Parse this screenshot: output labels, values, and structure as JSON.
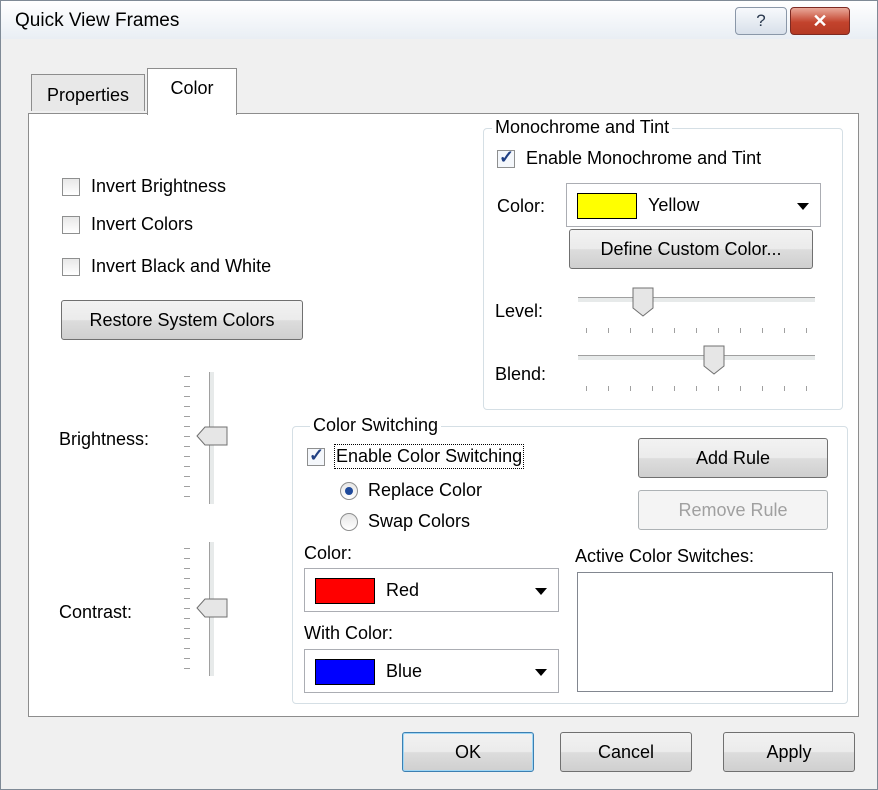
{
  "window": {
    "title": "Quick View Frames",
    "help_glyph": "?",
    "close_glyph": "✕"
  },
  "tabs": [
    {
      "label": "Properties"
    },
    {
      "label": "Color"
    }
  ],
  "left": {
    "invert_brightness": {
      "label": "Invert Brightness",
      "checked": false
    },
    "invert_colors": {
      "label": "Invert Colors",
      "checked": false
    },
    "invert_bw": {
      "label": "Invert Black and White",
      "checked": false
    },
    "restore_button": "Restore System Colors",
    "brightness_label": "Brightness:",
    "contrast_label": "Contrast:"
  },
  "mono": {
    "legend": "Monochrome and Tint",
    "enable": {
      "label": "Enable Monochrome and Tint",
      "checked": true
    },
    "color_label": "Color:",
    "color_value": "Yellow",
    "color_hex": "#ffff00",
    "define_button": "Define Custom Color...",
    "level_label": "Level:",
    "blend_label": "Blend:",
    "level": 0.25,
    "blend": 0.58
  },
  "switching": {
    "legend": "Color Switching",
    "enable": {
      "label": "Enable Color Switching",
      "checked": true
    },
    "replace": {
      "label": "Replace Color",
      "selected": true
    },
    "swap": {
      "label": "Swap Colors",
      "selected": false
    },
    "color_label": "Color:",
    "color_value": "Red",
    "color_hex": "#ff0000",
    "with_label": "With Color:",
    "with_value": "Blue",
    "with_hex": "#0000ff",
    "add_button": "Add Rule",
    "remove_button": "Remove Rule",
    "active_label": "Active Color Switches:",
    "active_items": []
  },
  "footer": {
    "ok": "OK",
    "cancel": "Cancel",
    "apply": "Apply"
  }
}
